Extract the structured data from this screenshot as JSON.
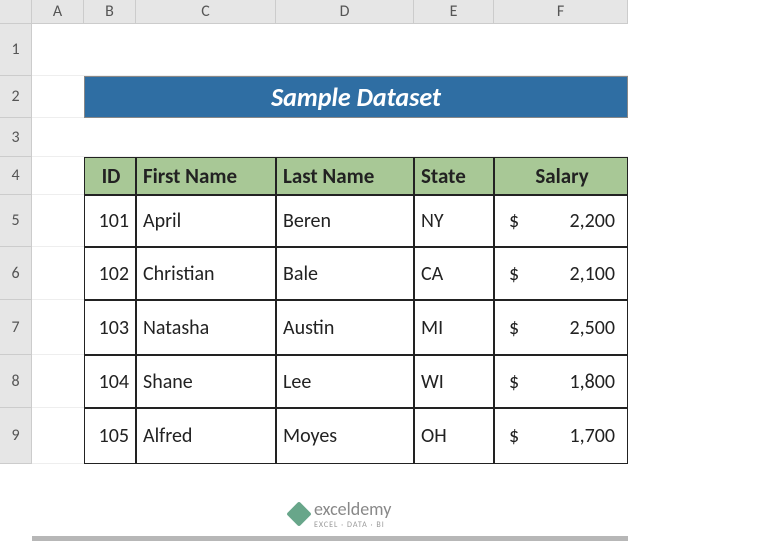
{
  "columns": [
    "A",
    "B",
    "C",
    "D",
    "E",
    "F"
  ],
  "rows": [
    "1",
    "2",
    "3",
    "4",
    "5",
    "6",
    "7",
    "8",
    "9"
  ],
  "title": "Sample Dataset",
  "headers": {
    "id": "ID",
    "first": "First Name",
    "last": "Last Name",
    "state": "State",
    "salary": "Salary"
  },
  "data": [
    {
      "id": "101",
      "first": "April",
      "last": "Beren",
      "state": "NY",
      "salary_sym": "$",
      "salary": "2,200"
    },
    {
      "id": "102",
      "first": "Christian",
      "last": "Bale",
      "state": "CA",
      "salary_sym": "$",
      "salary": "2,100"
    },
    {
      "id": "103",
      "first": "Natasha",
      "last": "Austin",
      "state": "MI",
      "salary_sym": "$",
      "salary": "2,500"
    },
    {
      "id": "104",
      "first": "Shane",
      "last": "Lee",
      "state": "WI",
      "salary_sym": "$",
      "salary": "1,800"
    },
    {
      "id": "105",
      "first": "Alfred",
      "last": "Moyes",
      "state": "OH",
      "salary_sym": "$",
      "salary": "1,700"
    }
  ],
  "watermark": {
    "brand": "exceldemy",
    "tag": "EXCEL · DATA · BI"
  }
}
